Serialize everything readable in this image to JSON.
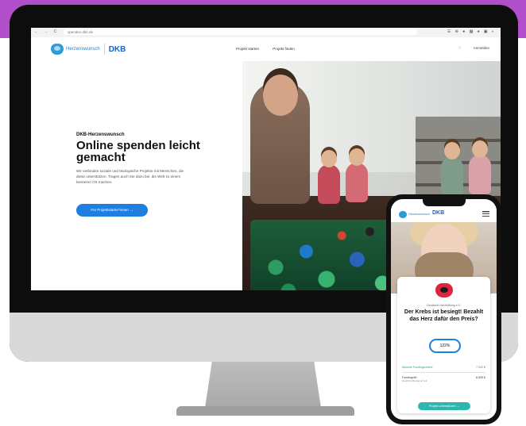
{
  "browser": {
    "nav_icons": "← → C ⌂",
    "url": "spenden.dkb.de",
    "extension_icons": "☰ ⊕ ● ▦ ♠ ▣ ◐"
  },
  "site": {
    "logo_text": "Herzenswunsch",
    "logo_brand": "DKB",
    "nav": [
      "Projekt starten",
      "Projekt finden"
    ],
    "header_right": [
      "♡",
      "Anmelden"
    ]
  },
  "hero": {
    "eyebrow": "DKB-Herzenswunsch",
    "headline": "Online spenden leicht gemacht",
    "description": "Wir verbinden soziale und ökologische Projekte mit Menschen, die diese unterstützen. Tragen auch Sie dazu bei, die Welt zu einem besseren Ort machen.",
    "cta_label": "Für Projektstarter*innen  →"
  },
  "phone": {
    "logo_text": "Herzenswunsch",
    "logo_brand": "DKB",
    "card": {
      "label": "Deutsche Herzstiftung e.V.",
      "title": "Der Krebs ist besiegt! Bezahlt das Herz dafür den Preis?",
      "percent": "122%",
      "row1_label": "Aktuelle Fundingsumme",
      "row1_value": "7.532 €",
      "row2_label": "Fundingziel",
      "row2_sub": "Restliche Betrag ist zeit.",
      "row2_value": "6.000 €",
      "button": "Projekt unterstützen  →"
    }
  },
  "colors": {
    "accent_purple": "#b04fc9",
    "cta_blue": "#1f7fe0",
    "brand_blue": "#1565c0",
    "teal": "#2bb6b0"
  }
}
